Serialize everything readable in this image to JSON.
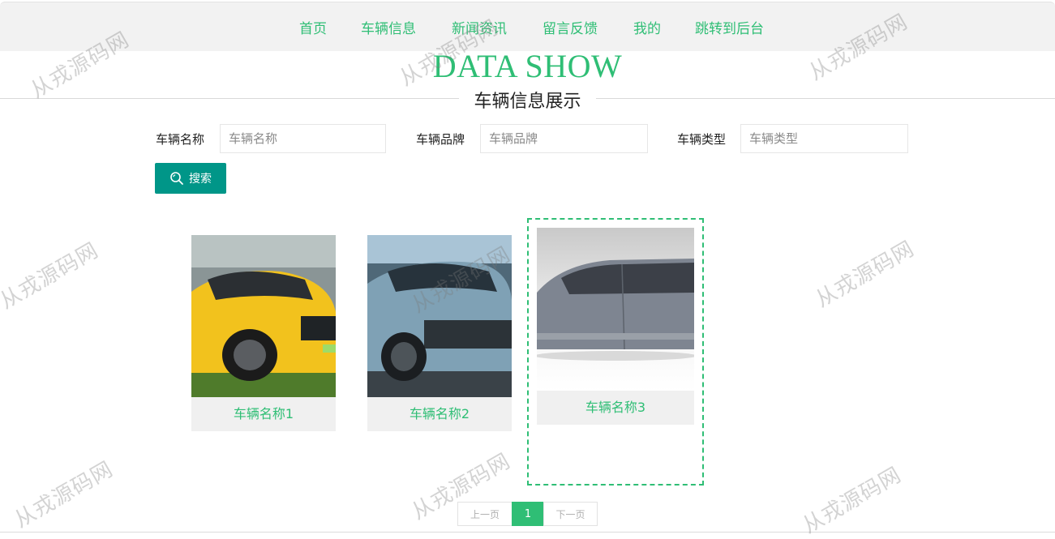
{
  "nav": {
    "items": [
      "首页",
      "车辆信息",
      "新闻资讯",
      "留言反馈",
      "我的",
      "跳转到后台"
    ]
  },
  "header": {
    "title_en": "DATA SHOW",
    "title_zh": "车辆信息展示"
  },
  "search": {
    "fields": [
      {
        "label": "车辆名称",
        "placeholder": "车辆名称"
      },
      {
        "label": "车辆品牌",
        "placeholder": "车辆品牌"
      },
      {
        "label": "车辆类型",
        "placeholder": "车辆类型"
      }
    ],
    "button_label": "搜索"
  },
  "cards": [
    {
      "name": "车辆名称1",
      "body_color": "#f2c21d"
    },
    {
      "name": "车辆名称2",
      "body_color": "#7fa1b5"
    },
    {
      "name": "车辆名称3",
      "body_color": "#7e8591"
    }
  ],
  "pagination": {
    "prev": "上一页",
    "current": "1",
    "next": "下一页"
  },
  "watermark": "从戎源码网",
  "colors": {
    "accent": "#2fbe75",
    "button": "#009688"
  }
}
